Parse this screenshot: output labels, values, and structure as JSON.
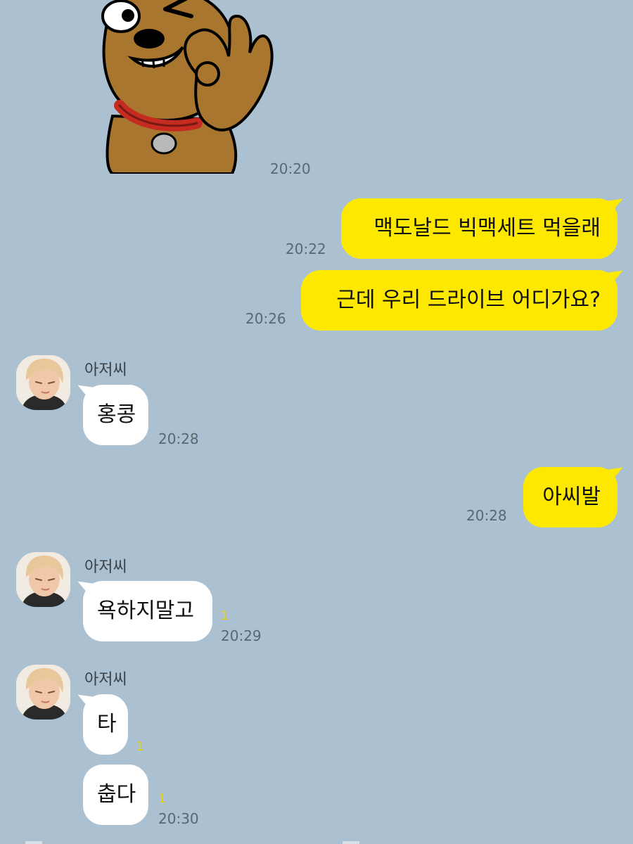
{
  "messages": [
    {
      "type": "sticker",
      "from": "me",
      "time": "20:20",
      "sticker_icon": "dog-ok-sticker-icon"
    },
    {
      "type": "text",
      "from": "me",
      "text": "맥도날드 빅맥세트 먹을래",
      "time": "20:22"
    },
    {
      "type": "text",
      "from": "me",
      "text": "근데 우리 드라이브 어디가요?",
      "time": "20:26"
    },
    {
      "type": "text",
      "from": "them",
      "sender": "아저씨",
      "text": "홍콩",
      "time": "20:28"
    },
    {
      "type": "text",
      "from": "me",
      "text": "아씨발",
      "time": "20:28"
    },
    {
      "type": "text",
      "from": "them",
      "sender": "아저씨",
      "text": "욕하지말고",
      "unread": "1",
      "time": "20:29"
    },
    {
      "type": "text",
      "from": "them",
      "sender": "아저씨",
      "text": "타",
      "unread": "1"
    },
    {
      "type": "text",
      "from": "them",
      "text": "춥다",
      "unread": "1",
      "time": "20:30"
    }
  ],
  "colors": {
    "background": "#abc1d1",
    "my_bubble": "#fde800",
    "their_bubble": "#ffffff",
    "unread_count": "#e8d400"
  }
}
